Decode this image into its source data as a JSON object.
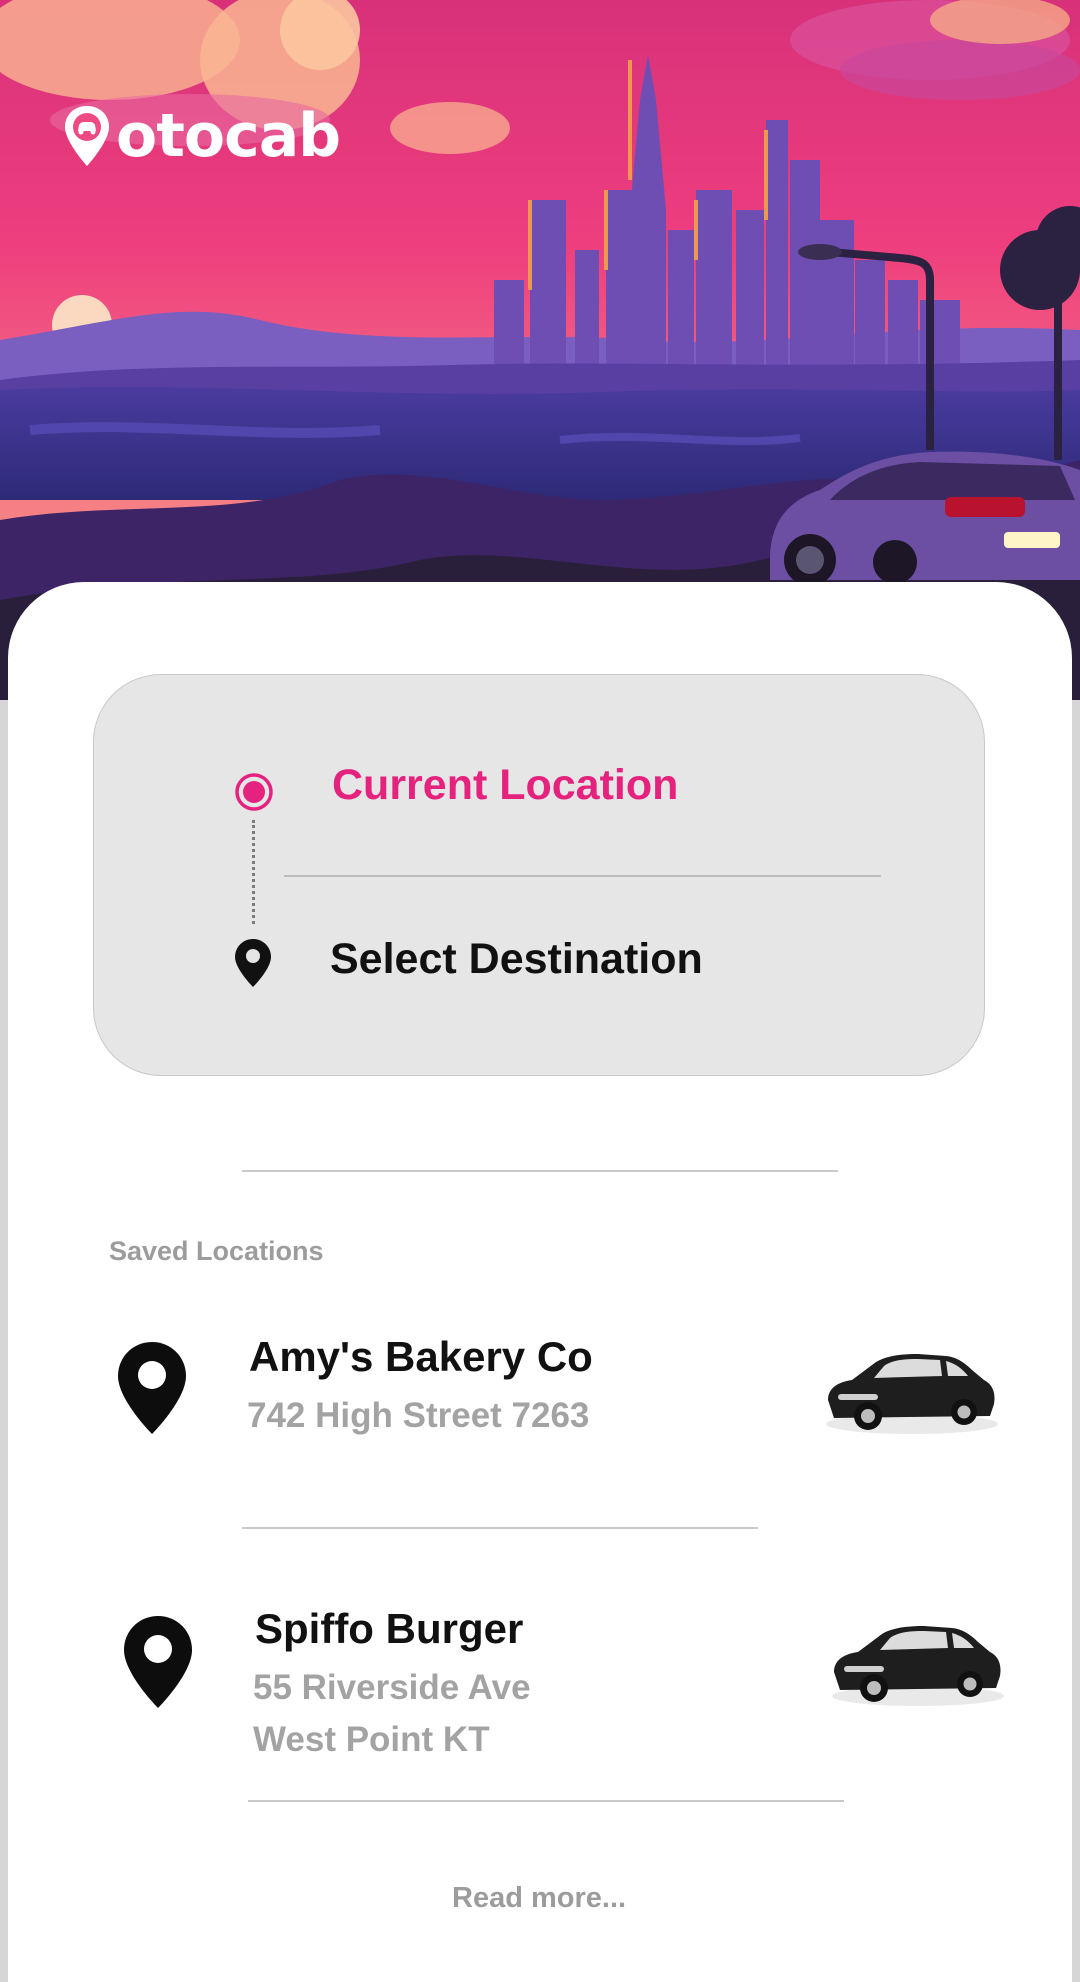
{
  "brand": {
    "name": "otocab",
    "accent": "#e5237e",
    "logo_icon": "car-pin-icon"
  },
  "route": {
    "current_label": "Current Location",
    "destination_label": "Select Destination",
    "current_icon": "target-dot-icon",
    "destination_icon": "map-pin-icon"
  },
  "saved": {
    "title": "Saved Locations",
    "items": [
      {
        "name": "Amy's Bakery Co",
        "address_lines": [
          "742 High Street 7263"
        ],
        "icon": "map-pin-icon",
        "thumb": "car-icon"
      },
      {
        "name": "Spiffo Burger",
        "address_lines": [
          "55 Riverside Ave",
          "West Point KT"
        ],
        "icon": "map-pin-icon",
        "thumb": "car-icon"
      }
    ]
  },
  "footer": {
    "read_more": "Read more..."
  }
}
